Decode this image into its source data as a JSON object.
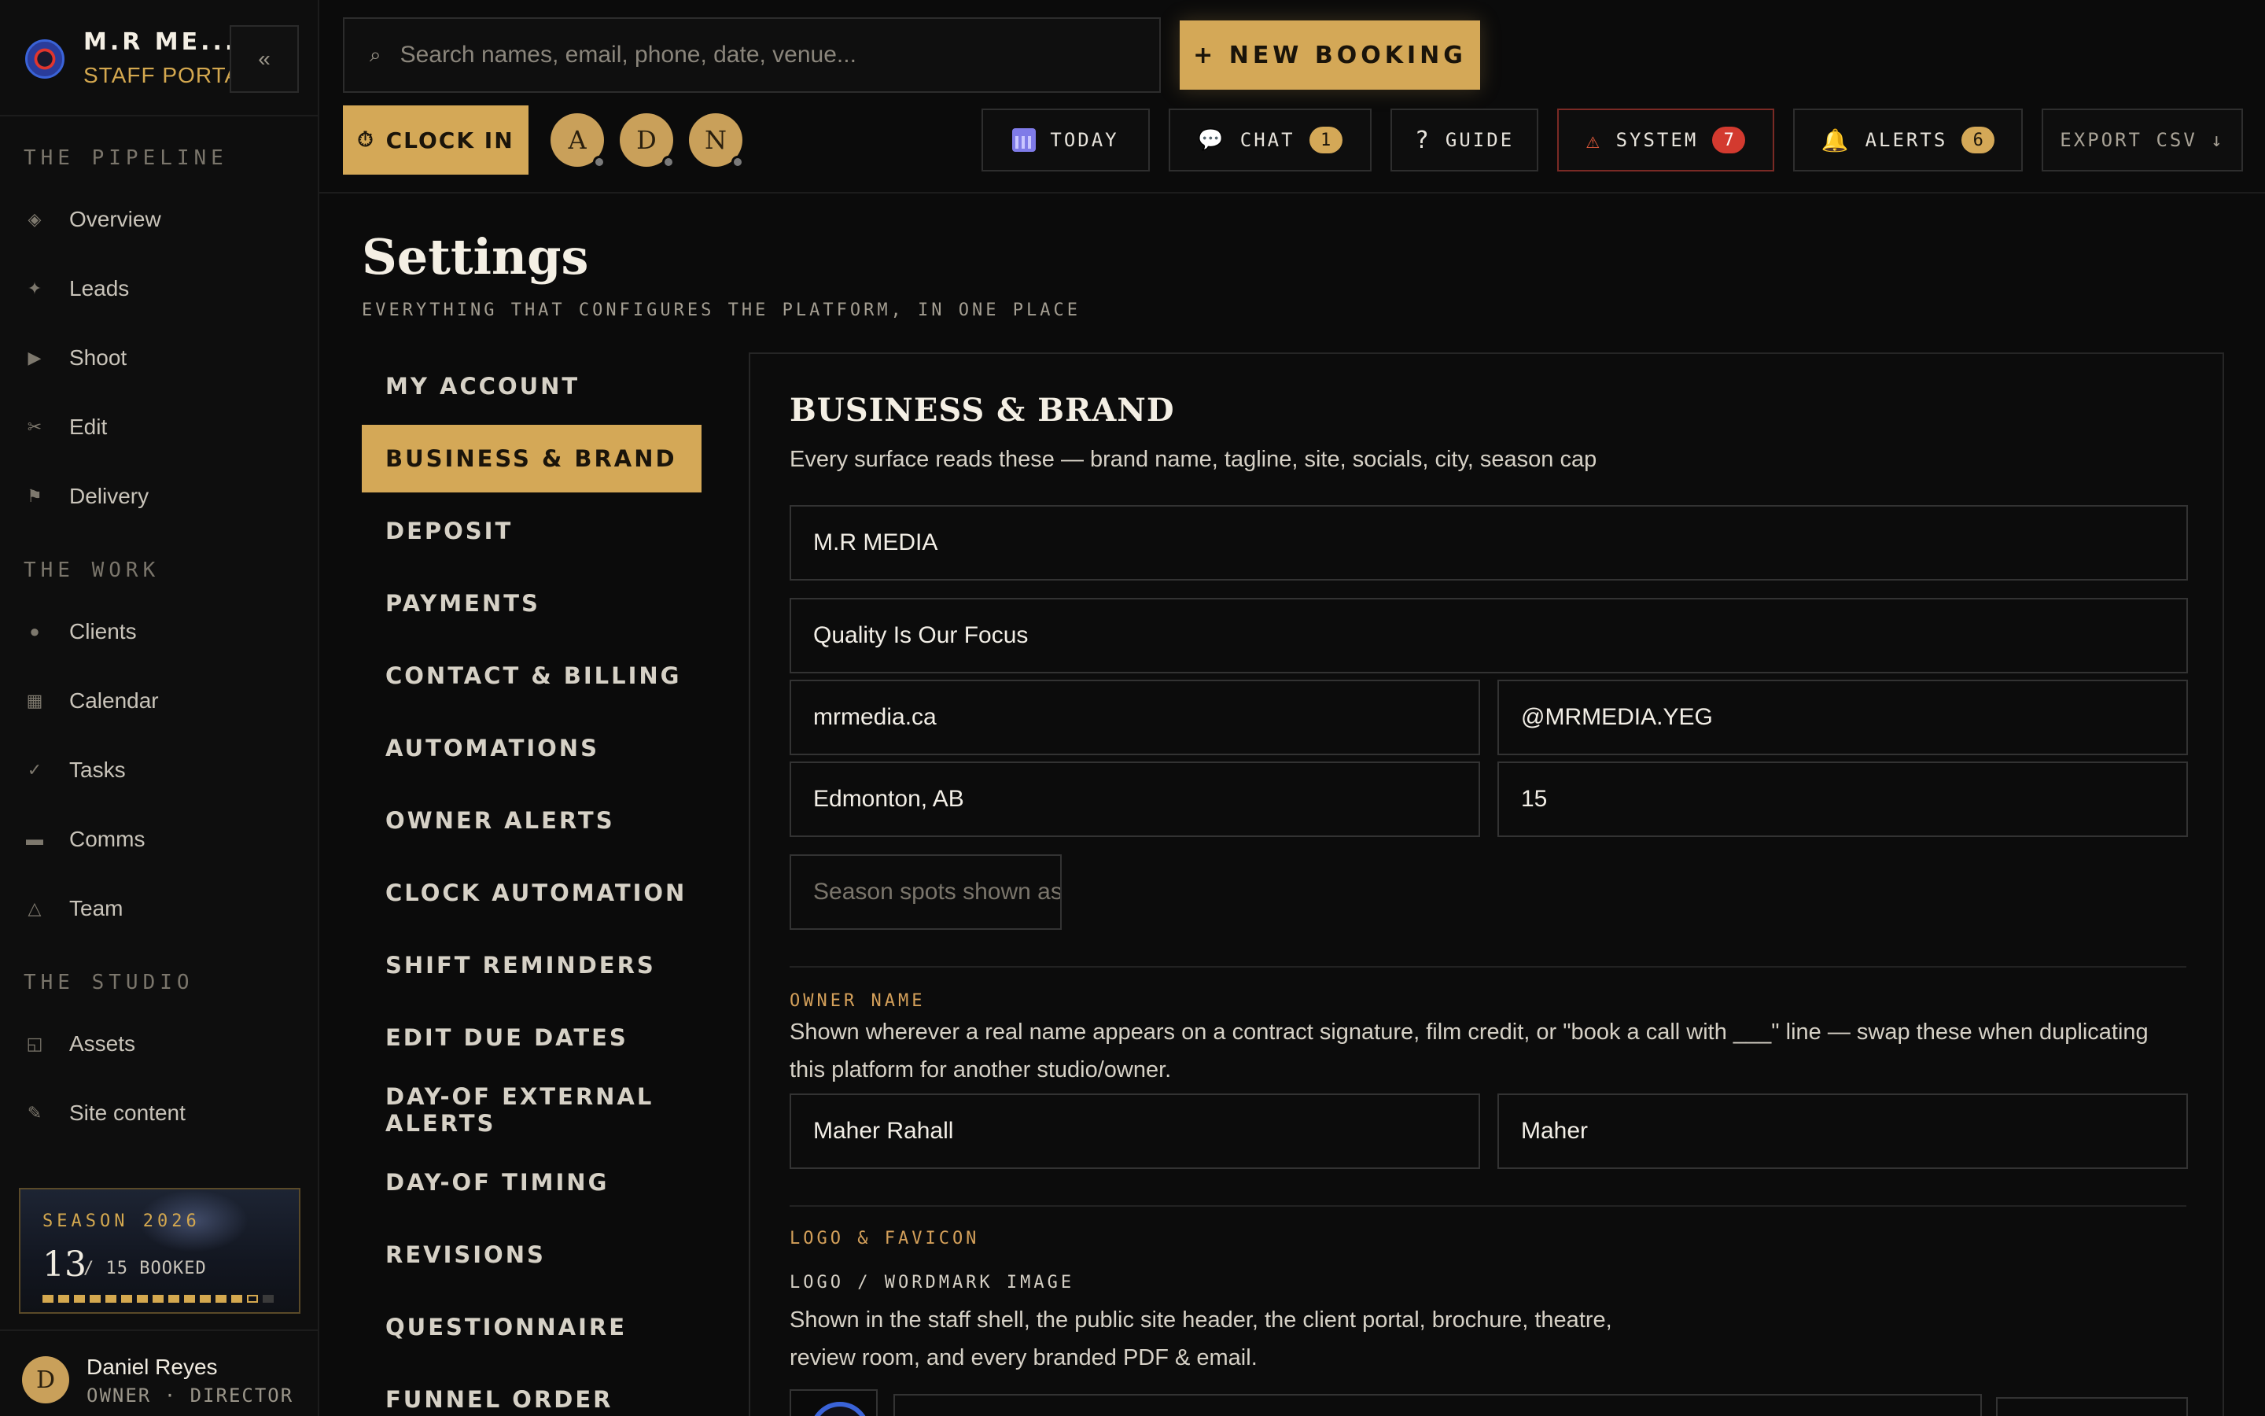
{
  "brand": {
    "name": "M.R ME...",
    "subtitle": "STAFF PORTAL",
    "collapse_label": "«"
  },
  "sidebar": {
    "sections": [
      {
        "title": "THE PIPELINE",
        "items": [
          {
            "label": "Overview",
            "icon": "◈"
          },
          {
            "label": "Leads",
            "icon": "✦"
          },
          {
            "label": "Shoot",
            "icon": "▶"
          },
          {
            "label": "Edit",
            "icon": "✂"
          },
          {
            "label": "Delivery",
            "icon": "⚑"
          }
        ]
      },
      {
        "title": "THE WORK",
        "items": [
          {
            "label": "Clients",
            "icon": "●"
          },
          {
            "label": "Calendar",
            "icon": "▦"
          },
          {
            "label": "Tasks",
            "icon": "✓"
          },
          {
            "label": "Comms",
            "icon": "▬"
          },
          {
            "label": "Team",
            "icon": "△"
          }
        ]
      },
      {
        "title": "THE STUDIO",
        "items": [
          {
            "label": "Assets",
            "icon": "◱"
          },
          {
            "label": "Site content",
            "icon": "✎"
          }
        ]
      }
    ],
    "season": {
      "title": "SEASON 2026",
      "booked": "13",
      "total_label": "/ 15 BOOKED",
      "booked_count": 13,
      "total": 15
    },
    "user": {
      "initial": "D",
      "name": "Daniel Reyes",
      "role": "OWNER · DIRECTOR"
    }
  },
  "header": {
    "search_placeholder": "Search names, email, phone, date, venue...",
    "search_icon": "⌕",
    "new_booking_label": "+ NEW BOOKING",
    "clock_in_label": "CLOCK IN",
    "clock_icon": "⏱",
    "presence": [
      "A",
      "D",
      "N"
    ],
    "buttons": {
      "today": "TODAY",
      "chat": "CHAT",
      "chat_count": "1",
      "guide": "GUIDE",
      "guide_icon": "?",
      "system": "SYSTEM",
      "system_count": "7",
      "alerts": "ALERTS",
      "alerts_count": "6",
      "export": "EXPORT CSV ↓"
    }
  },
  "page": {
    "title": "Settings",
    "subtitle": "EVERYTHING THAT CONFIGURES THE PLATFORM, IN ONE PLACE"
  },
  "settings_nav": [
    "MY ACCOUNT",
    "BUSINESS & BRAND",
    "DEPOSIT",
    "PAYMENTS",
    "CONTACT & BILLING",
    "AUTOMATIONS",
    "OWNER ALERTS",
    "CLOCK AUTOMATION",
    "SHIFT REMINDERS",
    "EDIT DUE DATES",
    "DAY-OF EXTERNAL ALERTS",
    "DAY-OF TIMING",
    "REVISIONS",
    "QUESTIONNAIRE",
    "FUNNEL ORDER"
  ],
  "settings_nav_active": "BUSINESS & BRAND",
  "panel": {
    "title": "BUSINESS & BRAND",
    "description": "Every surface reads these — brand name, tagline, site, socials, city, season cap",
    "fields": {
      "brand_name": "M.R MEDIA",
      "tagline": "Quality Is Our Focus",
      "site": "mrmedia.ca",
      "social": "@MRMEDIA.YEG",
      "city": "Edmonton, AB",
      "season_cap": "15",
      "season_spots_placeholder": "Season spots shown as"
    },
    "owner": {
      "label": "OWNER NAME",
      "help": "Shown wherever a real name appears on a contract signature, film credit, or \"book a call with ___\" line — swap these when duplicating this platform for another studio/owner.",
      "full_name": "Maher Rahall",
      "short_name": "Maher"
    },
    "logo": {
      "label": "LOGO & FAVICON",
      "sub_label": "LOGO / WORDMARK IMAGE",
      "help": "Shown in the staff shell, the public site header, the client portal, brochure, theatre, review room, and every branded PDF & email."
    }
  }
}
